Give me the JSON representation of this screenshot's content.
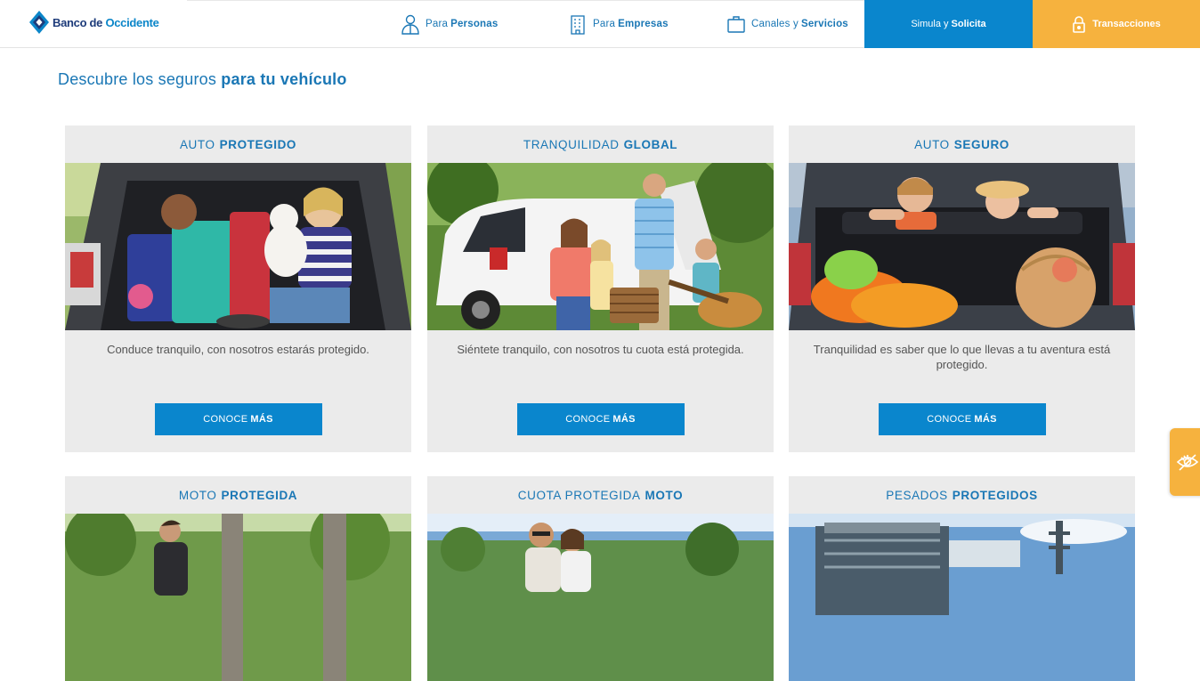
{
  "brand": {
    "name_part1": "Banco de ",
    "name_part2": "Occidente"
  },
  "nav": [
    {
      "light": "Para",
      "bold": "Personas",
      "icon": "person-icon"
    },
    {
      "light": "Para",
      "bold": "Empresas",
      "icon": "building-icon"
    },
    {
      "light": "Canales y",
      "bold": "Servicios",
      "icon": "briefcase-icon"
    }
  ],
  "simula": {
    "light": "Simula y",
    "bold": "Solicita"
  },
  "transacciones": {
    "label": "Transacciones",
    "icon": "lock-icon"
  },
  "page_title": {
    "light": "Descubre los seguros",
    "bold": "para tu vehículo"
  },
  "cards": [
    {
      "title_light": "AUTO",
      "title_bold": "PROTEGIDO",
      "description": "Conduce tranquilo, con nosotros estarás protegido.",
      "cta_light": "CONOCE",
      "cta_bold": "MÁS"
    },
    {
      "title_light": "TRANQUILIDAD",
      "title_bold": "GLOBAL",
      "description": "Siéntete tranquilo, con nosotros tu cuota está protegida.",
      "cta_light": "CONOCE",
      "cta_bold": "MÁS"
    },
    {
      "title_light": "AUTO",
      "title_bold": "SEGURO",
      "description": "Tranquilidad es saber que lo que llevas a tu aventura está protegido.",
      "cta_light": "CONOCE",
      "cta_bold": "MÁS"
    },
    {
      "title_light": "MOTO",
      "title_bold": "PROTEGIDA"
    },
    {
      "title_light": "CUOTA PROTEGIDA",
      "title_bold": "MOTO"
    },
    {
      "title_light": "PESADOS",
      "title_bold": "PROTEGIDOS"
    }
  ],
  "colors": {
    "primary": "#0a86cd",
    "accent": "#f6b23e",
    "text_blue": "#1a77b5",
    "card_bg": "#ebebeb"
  },
  "side_widget": {
    "icon": "accessibility-eye-icon"
  }
}
